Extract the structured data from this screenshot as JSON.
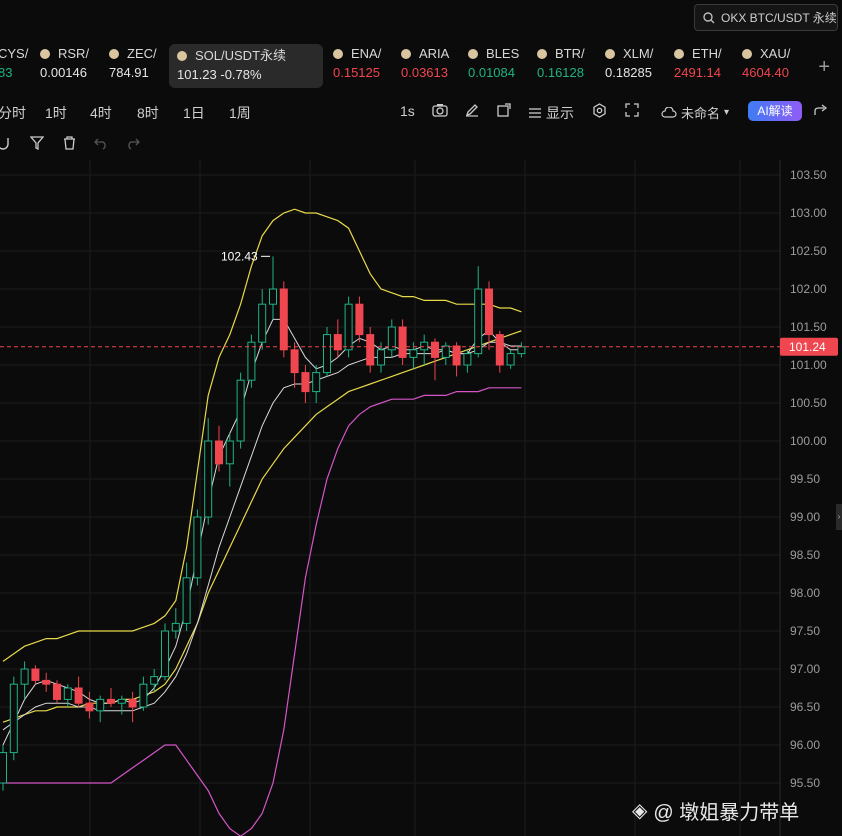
{
  "search": {
    "value": "OKX BTC/USDT 永续"
  },
  "tickers": [
    {
      "name": "CYS/",
      "price": "83",
      "trend": "up"
    },
    {
      "name": "RSR/",
      "price": "0.00146",
      "trend": "neutral"
    },
    {
      "name": "ZEC/",
      "price": "784.91",
      "trend": "neutral"
    },
    {
      "name": "SOL/USDT永续",
      "price": "101.23 -0.78%",
      "trend": "neutral",
      "active": true
    },
    {
      "name": "ENA/",
      "price": "0.15125",
      "trend": "down"
    },
    {
      "name": "ARIA",
      "price": "0.03613",
      "trend": "down"
    },
    {
      "name": "BLES",
      "price": "0.01084",
      "trend": "up"
    },
    {
      "name": "BTR/",
      "price": "0.16128",
      "trend": "up"
    },
    {
      "name": "XLM/",
      "price": "0.18285",
      "trend": "neutral"
    },
    {
      "name": "ETH/",
      "price": "2491.14",
      "trend": "down"
    },
    {
      "name": "XAU/",
      "price": "4604.40",
      "trend": "down"
    }
  ],
  "toolbar": {
    "intervals": [
      "分时",
      "1时",
      "4时",
      "8时",
      "1日",
      "1周"
    ],
    "timeframe": "1s",
    "display_label": "显示",
    "layout_name": "未命名",
    "ai_label": "AI解读"
  },
  "chart": {
    "price_ticks": [
      "103.50",
      "103.00",
      "102.50",
      "102.00",
      "101.50",
      "101.00",
      "100.50",
      "100.00",
      "99.50",
      "99.00",
      "98.50",
      "98.00",
      "97.50",
      "97.00",
      "96.50",
      "96.00",
      "95.50"
    ],
    "last_price": "101.24",
    "high_marker": "102.43",
    "colors": {
      "up": "#1fb385",
      "down": "#f0464f",
      "bb": "#e8d94a",
      "ma_white": "#d9d9d9",
      "ma_magenta": "#d455c8"
    }
  },
  "chart_data": {
    "type": "candlestick",
    "y_range": [
      95.4,
      103.6
    ],
    "last_price": 101.24,
    "high_marker": 102.43,
    "candles": [
      [
        95.5,
        96.0,
        95.4,
        95.9
      ],
      [
        95.9,
        96.9,
        95.8,
        96.8
      ],
      [
        96.8,
        97.1,
        96.6,
        97.0
      ],
      [
        97.0,
        97.05,
        96.8,
        96.85
      ],
      [
        96.85,
        96.95,
        96.7,
        96.8
      ],
      [
        96.8,
        96.85,
        96.55,
        96.6
      ],
      [
        96.6,
        96.8,
        96.5,
        96.75
      ],
      [
        96.75,
        96.9,
        96.5,
        96.55
      ],
      [
        96.55,
        96.7,
        96.35,
        96.45
      ],
      [
        96.45,
        96.65,
        96.3,
        96.6
      ],
      [
        96.6,
        96.75,
        96.5,
        96.55
      ],
      [
        96.55,
        96.65,
        96.4,
        96.6
      ],
      [
        96.6,
        96.7,
        96.3,
        96.5
      ],
      [
        96.5,
        96.9,
        96.45,
        96.8
      ],
      [
        96.8,
        97.0,
        96.7,
        96.9
      ],
      [
        96.9,
        97.6,
        96.85,
        97.5
      ],
      [
        97.5,
        97.8,
        97.4,
        97.6
      ],
      [
        97.6,
        98.4,
        97.5,
        98.2
      ],
      [
        98.2,
        99.1,
        98.1,
        99.0
      ],
      [
        99.0,
        100.3,
        98.9,
        100.0
      ],
      [
        100.0,
        100.2,
        99.6,
        99.7
      ],
      [
        99.7,
        100.1,
        99.4,
        100.0
      ],
      [
        100.0,
        100.9,
        99.9,
        100.8
      ],
      [
        100.8,
        101.4,
        100.7,
        101.3
      ],
      [
        101.3,
        102.0,
        101.2,
        101.8
      ],
      [
        101.8,
        102.43,
        101.6,
        102.0
      ],
      [
        102.0,
        102.1,
        101.1,
        101.2
      ],
      [
        101.2,
        101.3,
        100.7,
        100.9
      ],
      [
        100.9,
        101.0,
        100.5,
        100.65
      ],
      [
        100.65,
        101.0,
        100.5,
        100.9
      ],
      [
        100.9,
        101.5,
        100.85,
        101.4
      ],
      [
        101.4,
        101.6,
        101.1,
        101.2
      ],
      [
        101.2,
        101.9,
        101.1,
        101.8
      ],
      [
        101.8,
        101.9,
        101.3,
        101.4
      ],
      [
        101.4,
        101.5,
        100.9,
        101.0
      ],
      [
        101.0,
        101.3,
        100.9,
        101.2
      ],
      [
        101.2,
        101.6,
        101.1,
        101.5
      ],
      [
        101.5,
        101.6,
        101.0,
        101.1
      ],
      [
        101.1,
        101.3,
        100.95,
        101.2
      ],
      [
        101.2,
        101.4,
        101.0,
        101.3
      ],
      [
        101.3,
        101.35,
        100.8,
        101.1
      ],
      [
        101.1,
        101.3,
        101.0,
        101.25
      ],
      [
        101.25,
        101.3,
        100.85,
        101.0
      ],
      [
        101.0,
        101.2,
        100.9,
        101.15
      ],
      [
        101.15,
        102.3,
        101.1,
        102.0
      ],
      [
        102.0,
        102.1,
        101.2,
        101.4
      ],
      [
        101.4,
        101.45,
        100.9,
        101.0
      ],
      [
        101.0,
        101.2,
        100.95,
        101.15
      ],
      [
        101.15,
        101.3,
        101.1,
        101.24
      ]
    ],
    "bb_upper": [
      97.1,
      97.2,
      97.3,
      97.35,
      97.4,
      97.4,
      97.45,
      97.5,
      97.5,
      97.5,
      97.5,
      97.5,
      97.5,
      97.55,
      97.6,
      97.7,
      97.9,
      98.6,
      99.6,
      100.6,
      101.1,
      101.4,
      101.8,
      102.3,
      102.7,
      102.9,
      103.0,
      103.05,
      103.0,
      103.0,
      102.95,
      102.9,
      102.8,
      102.5,
      102.2,
      102.0,
      101.95,
      101.9,
      101.9,
      101.85,
      101.85,
      101.85,
      101.8,
      101.8,
      101.8,
      101.8,
      101.75,
      101.75,
      101.7
    ],
    "bb_mid": [
      96.3,
      96.35,
      96.4,
      96.45,
      96.45,
      96.5,
      96.5,
      96.5,
      96.55,
      96.55,
      96.55,
      96.6,
      96.6,
      96.65,
      96.7,
      96.8,
      97.0,
      97.3,
      97.6,
      98.0,
      98.3,
      98.6,
      98.9,
      99.2,
      99.5,
      99.7,
      99.9,
      100.05,
      100.2,
      100.35,
      100.45,
      100.55,
      100.65,
      100.7,
      100.75,
      100.8,
      100.85,
      100.9,
      100.95,
      101.0,
      101.05,
      101.1,
      101.15,
      101.2,
      101.25,
      101.3,
      101.35,
      101.4,
      101.45
    ],
    "ma_fast": [
      96.0,
      96.3,
      96.6,
      96.8,
      96.85,
      96.8,
      96.75,
      96.7,
      96.6,
      96.55,
      96.55,
      96.6,
      96.55,
      96.6,
      96.75,
      97.0,
      97.3,
      97.8,
      98.5,
      99.2,
      99.8,
      100.1,
      100.4,
      100.9,
      101.3,
      101.6,
      101.6,
      101.35,
      101.1,
      100.95,
      101.0,
      101.1,
      101.25,
      101.35,
      101.3,
      101.2,
      101.25,
      101.2,
      101.2,
      101.25,
      101.2,
      101.2,
      101.15,
      101.15,
      101.35,
      101.45,
      101.3,
      101.2,
      101.2
    ],
    "ma_slow": [
      96.2,
      96.3,
      96.4,
      96.5,
      96.55,
      96.55,
      96.55,
      96.5,
      96.5,
      96.45,
      96.45,
      96.45,
      96.45,
      96.5,
      96.55,
      96.7,
      96.9,
      97.2,
      97.6,
      98.1,
      98.6,
      99.0,
      99.4,
      99.8,
      100.2,
      100.5,
      100.7,
      100.75,
      100.75,
      100.8,
      100.85,
      100.9,
      101.0,
      101.05,
      101.1,
      101.1,
      101.1,
      101.15,
      101.15,
      101.15,
      101.15,
      101.2,
      101.15,
      101.15,
      101.2,
      101.3,
      101.3,
      101.25,
      101.25
    ],
    "bb_lower": [
      95.5,
      95.5,
      95.5,
      95.5,
      95.5,
      95.5,
      95.5,
      95.5,
      95.5,
      95.5,
      95.5,
      95.6,
      95.7,
      95.8,
      95.9,
      96.0,
      96.0,
      95.8,
      95.6,
      95.4,
      95.1,
      94.9,
      94.8,
      94.9,
      95.1,
      95.5,
      96.2,
      97.2,
      98.2,
      98.9,
      99.5,
      99.9,
      100.2,
      100.35,
      100.45,
      100.5,
      100.55,
      100.55,
      100.55,
      100.6,
      100.6,
      100.6,
      100.65,
      100.65,
      100.65,
      100.7,
      100.7,
      100.7,
      100.7
    ]
  },
  "watermark": "@ 墩姐暴力带单"
}
